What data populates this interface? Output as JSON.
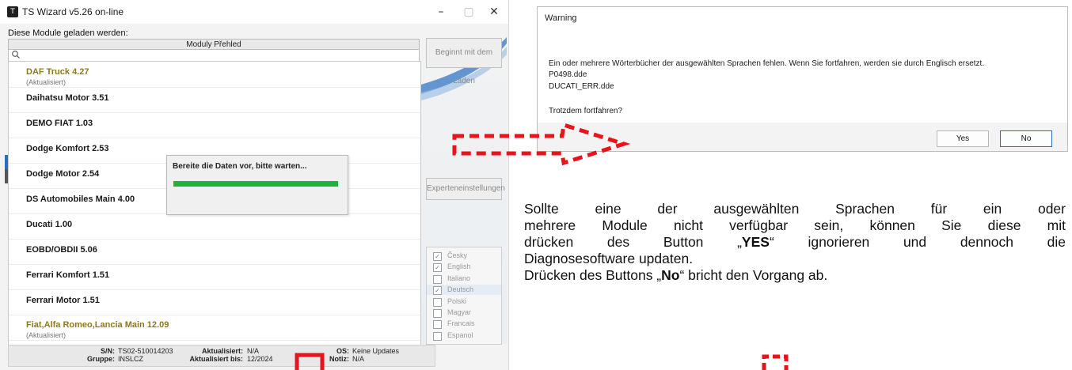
{
  "wizard": {
    "title": "TS Wizard v5.26 on-line",
    "loaded_label": "Diese Module geladen werden:",
    "list_header": "Moduly Přehled",
    "modules": [
      {
        "name": "DAF Truck 4.27",
        "sub": "(Aktualisiert)",
        "updated": true
      },
      {
        "name": "Daihatsu Motor 3.51",
        "sub": "",
        "updated": false
      },
      {
        "name": "DEMO FIAT 1.03",
        "sub": "",
        "updated": false
      },
      {
        "name": "Dodge Komfort 2.53",
        "sub": "",
        "updated": false
      },
      {
        "name": "Dodge Motor 2.54",
        "sub": "",
        "updated": false
      },
      {
        "name": "DS Automobiles Main 4.00",
        "sub": "",
        "updated": false
      },
      {
        "name": "Ducati 1.00",
        "sub": "",
        "updated": false
      },
      {
        "name": "EOBD/OBDII 5.06",
        "sub": "",
        "updated": false
      },
      {
        "name": "Ferrari Komfort 1.51",
        "sub": "",
        "updated": false
      },
      {
        "name": "Ferrari Motor 1.51",
        "sub": "",
        "updated": false
      },
      {
        "name": "Fiat,Alfa Romeo,Lancia Main 12.09",
        "sub": "(Aktualisiert)",
        "updated": true
      }
    ],
    "begin_button": "Beginnt mit dem Laden",
    "expert_button": "Experteneinstellungen",
    "languages": [
      {
        "label": "Česky",
        "checked": true
      },
      {
        "label": "English",
        "checked": true
      },
      {
        "label": "Italiano",
        "checked": false
      },
      {
        "label": "Deutsch",
        "checked": true
      },
      {
        "label": "Polski",
        "checked": false
      },
      {
        "label": "Magyar",
        "checked": false
      },
      {
        "label": "Francais",
        "checked": false
      },
      {
        "label": "Espanol",
        "checked": false
      }
    ],
    "progress": {
      "text": "Bereite die Daten vor, bitte warten...",
      "fraction": 1.0
    },
    "status": {
      "sn_label": "S/N:",
      "sn_value": "TS02-510014203",
      "group_label": "Gruppe:",
      "group_value": "INSLCZ",
      "updated_label": "Aktualisiert:",
      "updated_value": "N/A",
      "updated_until_label": "Aktualisiert bis:",
      "updated_until_value": "12/2024",
      "os_label": "OS:",
      "os_value": "Keine Updates",
      "note_label": "Notiz:",
      "note_value": "N/A"
    }
  },
  "warning": {
    "title": "Warning",
    "lines": [
      "Ein oder mehrere Wörterbücher der ausgewählten Sprachen fehlen. Wenn Sie fortfahren, werden sie durch Englisch ersetzt.",
      "P0498.dde",
      "DUCATI_ERR.dde",
      "",
      "Trotzdem fortfahren?"
    ],
    "yes_label": "Yes",
    "no_label": "No"
  },
  "description": {
    "l1": "Sollte eine der ausgewählten Sprachen für ein oder",
    "l2": "mehrere Module nicht verfügbar sein, können Sie diese mit",
    "l3a": "drücken des Button „",
    "l3b": "YES",
    "l3c": "“ ignorieren und dennoch die",
    "l4": "Diagnosesoftware updaten.",
    "l5a": "Drücken des Buttons „",
    "l5b": "No",
    "l5c": "“ bricht den Vorgang ab."
  },
  "colors": {
    "annotation_red": "#e8141b",
    "progress_green": "#1fb33a",
    "updated_module": "#8a7a1a"
  }
}
